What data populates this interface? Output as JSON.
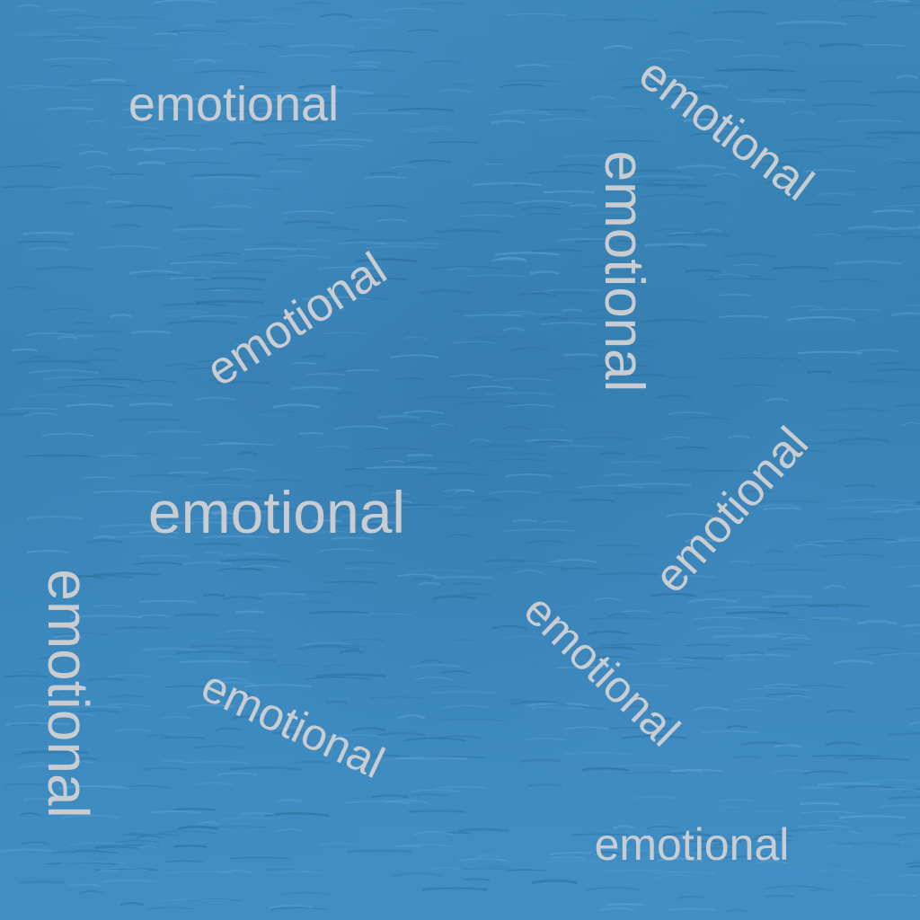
{
  "background": {
    "description_colors": {
      "water_base": "#3a87b8",
      "water_highlight": "#5aa2d6",
      "water_shadow": "#2a6f9e",
      "text": "#c9cdd2"
    }
  },
  "words": [
    {
      "text": "emotional"
    },
    {
      "text": "emotional"
    },
    {
      "text": "emotional"
    },
    {
      "text": "emotional"
    },
    {
      "text": "emotional"
    },
    {
      "text": "emotional"
    },
    {
      "text": "emotional"
    },
    {
      "text": "emotional"
    },
    {
      "text": "emotional"
    },
    {
      "text": "emotional"
    }
  ]
}
